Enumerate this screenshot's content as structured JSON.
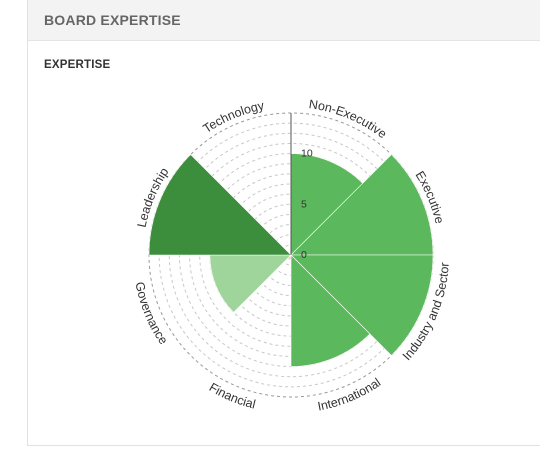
{
  "panel": {
    "title": "BOARD EXPERTISE"
  },
  "section": {
    "title": "EXPERTISE"
  },
  "colors": {
    "grid": "#c8c8c8",
    "outer_ring": "#999999",
    "axis_line": "#555555",
    "label_text": "#333333"
  },
  "chart_data": {
    "type": "polar-area",
    "categories": [
      "Non-Executive",
      "Executive",
      "Industry and Sector",
      "International",
      "Financial",
      "Governance",
      "Leadership",
      "Technology"
    ],
    "values": [
      10,
      14,
      14,
      11,
      0.5,
      8,
      14,
      0
    ],
    "colors": [
      "#5cb85c",
      "#5cb85c",
      "#5cb85c",
      "#5cb85c",
      "#f5c6c6",
      "#9fd49a",
      "#3c8d3c",
      "#5cb85c"
    ],
    "r_ticks": [
      0,
      5,
      10
    ],
    "r_max": 14,
    "grid_rings": 14
  }
}
